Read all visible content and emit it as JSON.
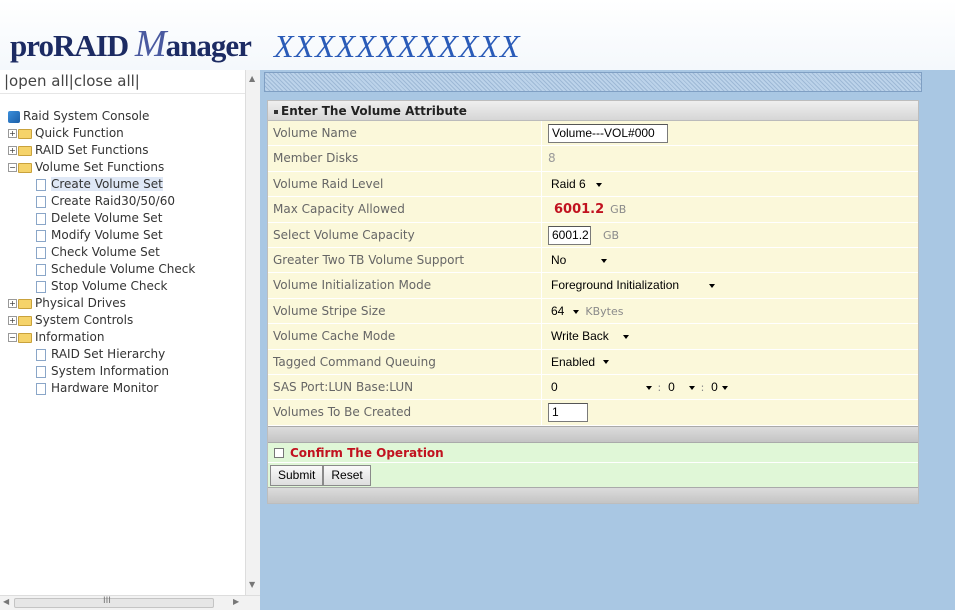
{
  "header": {
    "logo_prefix": "proRAID",
    "logo_m": "M",
    "logo_suffix": "anager",
    "brand": "XXXXXXXXXXXX"
  },
  "sidebar": {
    "open_all": "|open all|",
    "close_all": "close all|",
    "root": "Raid System Console",
    "items": [
      {
        "label": "Quick Function",
        "type": "folder",
        "expanded": false
      },
      {
        "label": "RAID Set Functions",
        "type": "folder",
        "expanded": false
      },
      {
        "label": "Volume Set Functions",
        "type": "folder",
        "expanded": true
      },
      {
        "label": "Create Volume Set",
        "type": "page",
        "selected": true
      },
      {
        "label": "Create Raid30/50/60",
        "type": "page"
      },
      {
        "label": "Delete Volume Set",
        "type": "page"
      },
      {
        "label": "Modify Volume Set",
        "type": "page"
      },
      {
        "label": "Check Volume Set",
        "type": "page"
      },
      {
        "label": "Schedule Volume Check",
        "type": "page"
      },
      {
        "label": "Stop Volume Check",
        "type": "page"
      },
      {
        "label": "Physical Drives",
        "type": "folder",
        "expanded": false
      },
      {
        "label": "System Controls",
        "type": "folder",
        "expanded": false
      },
      {
        "label": "Information",
        "type": "folder",
        "expanded": true
      },
      {
        "label": "RAID Set Hierarchy",
        "type": "page"
      },
      {
        "label": "System Information",
        "type": "page"
      },
      {
        "label": "Hardware Monitor",
        "type": "page"
      }
    ],
    "scroll_grip": "III"
  },
  "form": {
    "title": "Enter The Volume Attribute",
    "rows": {
      "volume_name": {
        "label": "Volume Name",
        "value": "Volume---VOL#000"
      },
      "member_disks": {
        "label": "Member Disks",
        "value": "8"
      },
      "raid_level": {
        "label": "Volume Raid Level",
        "value": "Raid 6"
      },
      "max_capacity": {
        "label": "Max Capacity Allowed",
        "value": "6001.2",
        "unit": "GB"
      },
      "select_capacity": {
        "label": "Select Volume Capacity",
        "value": "6001.2",
        "unit": "GB"
      },
      "two_tb": {
        "label": "Greater Two TB Volume Support",
        "value": "No"
      },
      "init_mode": {
        "label": "Volume Initialization Mode",
        "value": "Foreground Initialization"
      },
      "stripe_size": {
        "label": "Volume Stripe Size",
        "value": "64",
        "unit": "KBytes"
      },
      "cache_mode": {
        "label": "Volume Cache Mode",
        "value": "Write Back"
      },
      "tcq": {
        "label": "Tagged Command Queuing",
        "value": "Enabled"
      },
      "sas_lun": {
        "label": "SAS Port:LUN Base:LUN",
        "port": "0",
        "sep1": ":",
        "base": "0",
        "sep2": ":",
        "lun": "0"
      },
      "to_create": {
        "label": "Volumes To Be Created",
        "value": "1"
      }
    },
    "confirm_label": "Confirm The Operation",
    "submit_label": "Submit",
    "reset_label": "Reset"
  }
}
